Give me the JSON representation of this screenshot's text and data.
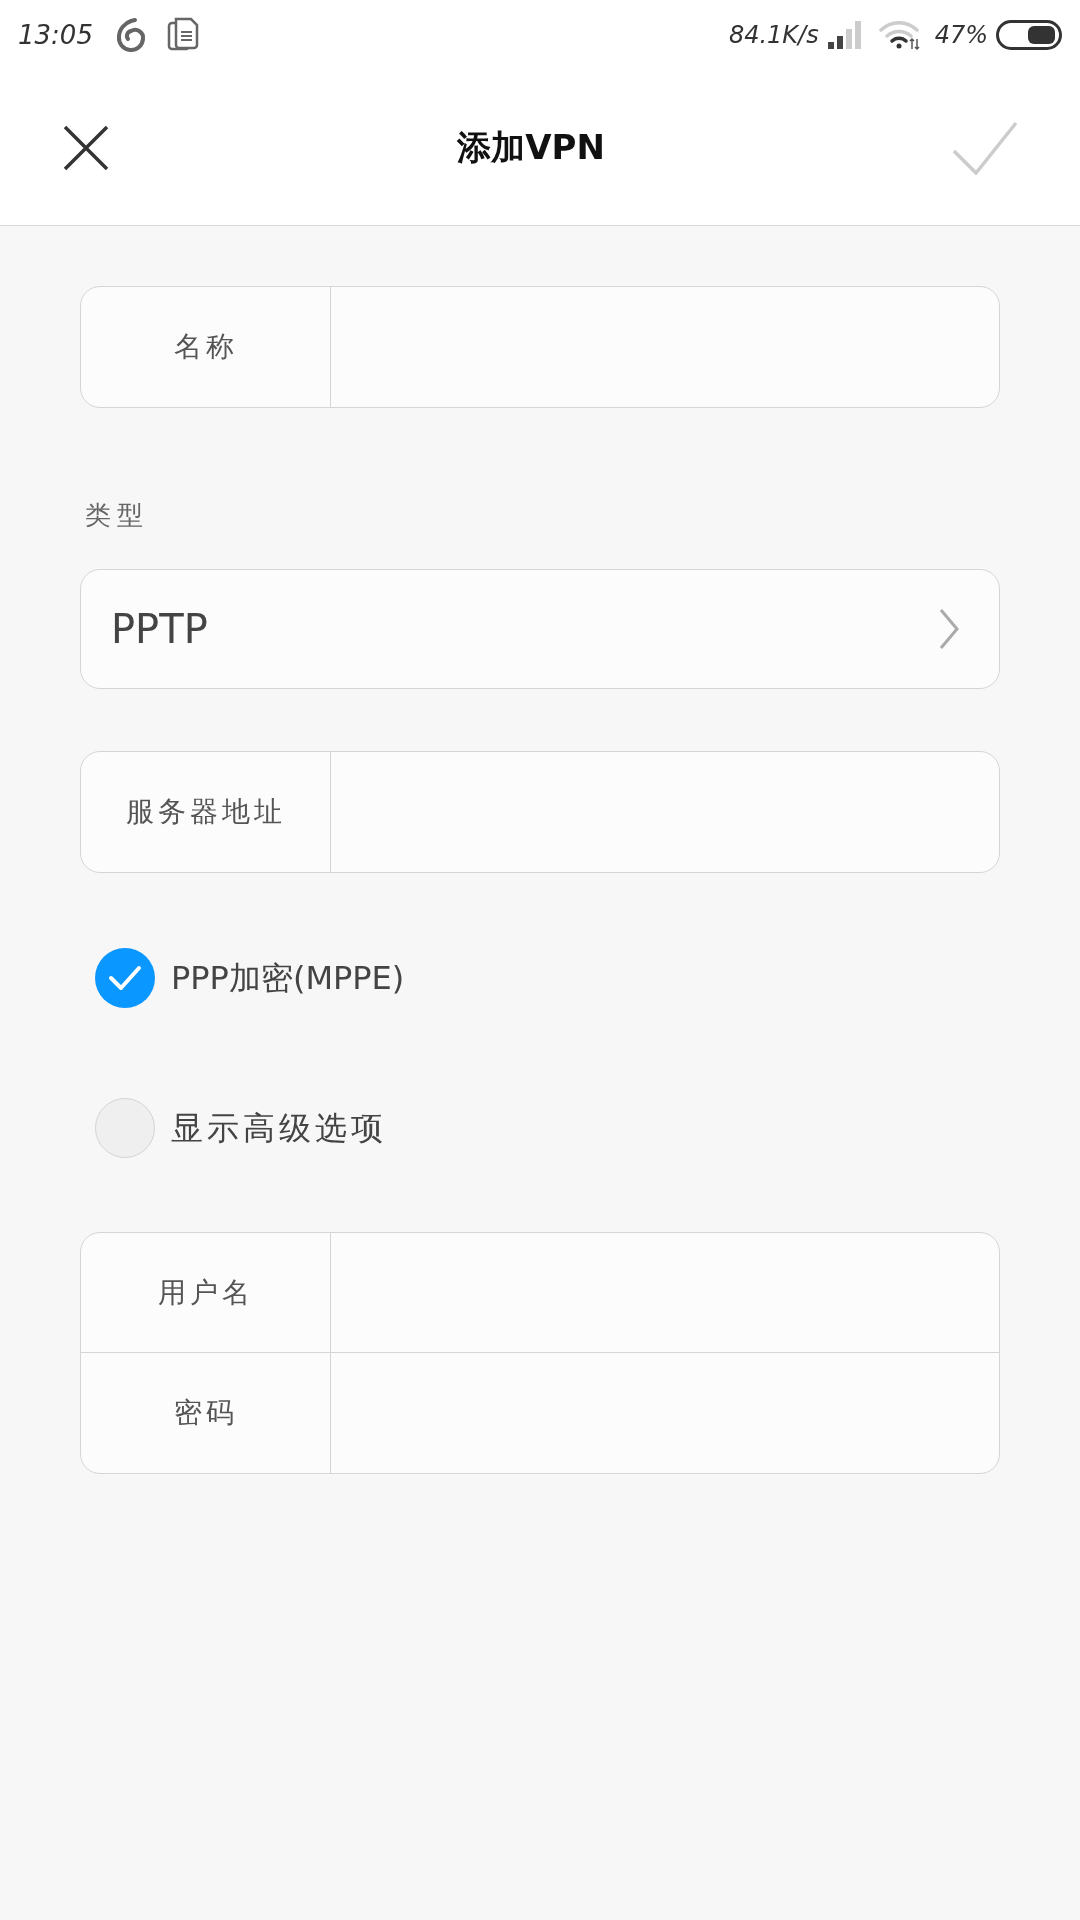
{
  "status_bar": {
    "time": "13:05",
    "network_speed": "84.1K/s",
    "battery_percent": "47%"
  },
  "header": {
    "title": "添加VPN",
    "confirm": {
      "disabled": true
    }
  },
  "name_field": {
    "label": "名称"
  },
  "type_section": {
    "label": "类型",
    "value": "PPTP"
  },
  "server_field": {
    "label": "服务器地址"
  },
  "options": [
    {
      "label": "PPP加密(MPPE)",
      "checked": true
    },
    {
      "label": "显示高级选项",
      "checked": false
    }
  ],
  "credentials": [
    {
      "label": "用户名"
    },
    {
      "label": "密码"
    }
  ]
}
